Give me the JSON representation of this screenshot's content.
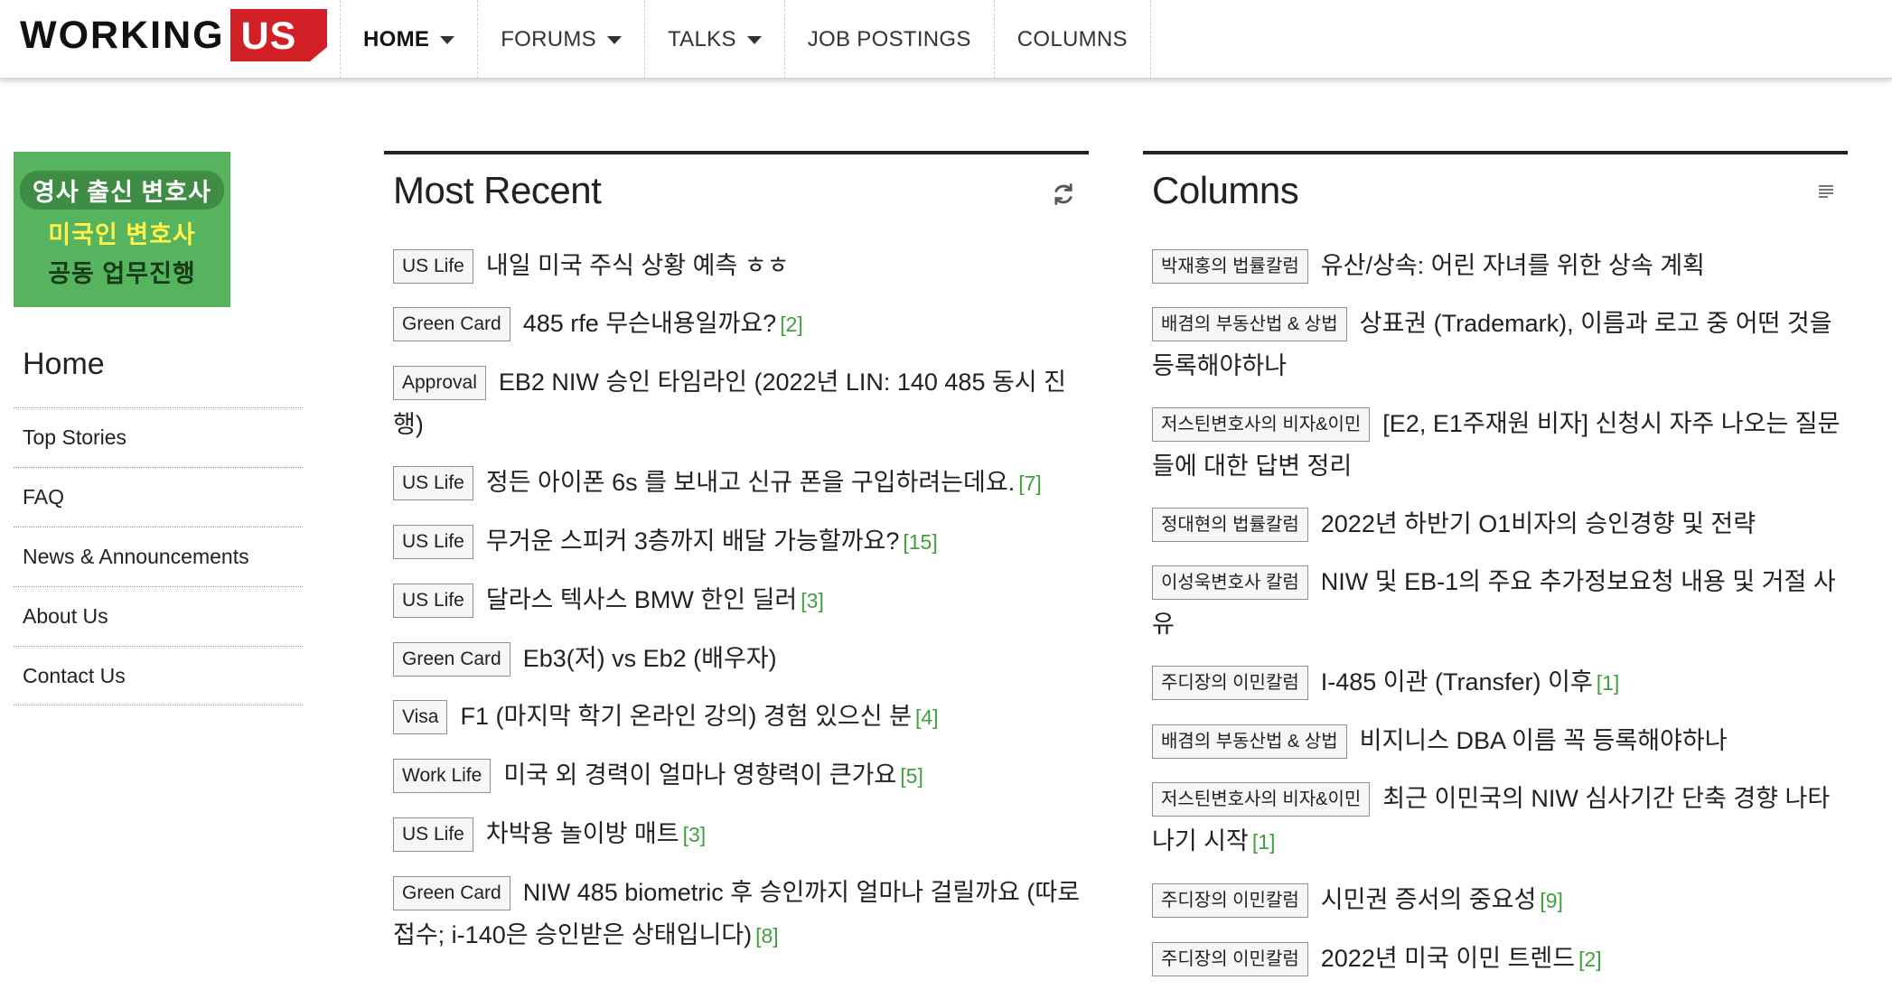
{
  "logo": {
    "word": "WORKING",
    "badge": "US"
  },
  "nav": [
    {
      "label": "HOME",
      "active": true,
      "dropdown": true
    },
    {
      "label": "FORUMS",
      "active": false,
      "dropdown": true
    },
    {
      "label": "TALKS",
      "active": false,
      "dropdown": true
    },
    {
      "label": "JOB POSTINGS",
      "active": false,
      "dropdown": false
    },
    {
      "label": "COLUMNS",
      "active": false,
      "dropdown": false
    }
  ],
  "ad": {
    "line1": "영사 출신 변호사",
    "line2": "미국인 변호사",
    "line3": "공동 업무진행"
  },
  "sidebar": {
    "title": "Home",
    "items": [
      "Top Stories",
      "FAQ",
      "News & Announcements",
      "About Us",
      "Contact Us"
    ]
  },
  "most_recent": {
    "title": "Most Recent",
    "icon": "refresh-icon",
    "items": [
      {
        "tag": "US Life",
        "title": "내일 미국 주식 상황 예측 ㅎㅎ",
        "count": ""
      },
      {
        "tag": "Green Card",
        "title": "485 rfe 무슨내용일까요?",
        "count": "[2]"
      },
      {
        "tag": "Approval",
        "title": "EB2 NIW 승인 타임라인 (2022년 LIN: 140 485 동시 진행)",
        "count": ""
      },
      {
        "tag": "US Life",
        "title": "정든 아이폰 6s 를 보내고 신규 폰을 구입하려는데요.",
        "count": "[7]"
      },
      {
        "tag": "US Life",
        "title": "무거운 스피커 3층까지 배달 가능할까요?",
        "count": "[15]"
      },
      {
        "tag": "US Life",
        "title": "달라스 텍사스 BMW 한인 딜러",
        "count": "[3]"
      },
      {
        "tag": "Green Card",
        "title": "Eb3(저) vs Eb2 (배우자)",
        "count": ""
      },
      {
        "tag": "Visa",
        "title": "F1 (마지막 학기 온라인 강의) 경험 있으신 분",
        "count": "[4]"
      },
      {
        "tag": "Work Life",
        "title": "미국 외 경력이 얼마나 영향력이 큰가요",
        "count": "[5]"
      },
      {
        "tag": "US Life",
        "title": "차박용 놀이방 매트",
        "count": "[3]"
      },
      {
        "tag": "Green Card",
        "title": "NIW 485 biometric 후 승인까지 얼마나 걸릴까요 (따로 접수; i-140은 승인받은 상태입니다)",
        "count": "[8]"
      }
    ]
  },
  "columns": {
    "title": "Columns",
    "icon": "list-icon",
    "items": [
      {
        "tag": "박재홍의 법률칼럼",
        "title": "유산/상속: 어린 자녀를 위한 상속 계획",
        "count": ""
      },
      {
        "tag": "배겸의 부동산법 & 상법",
        "title": "상표권 (Trademark), 이름과 로고 중 어떤 것을 등록해야하나",
        "count": ""
      },
      {
        "tag": "저스틴변호사의 비자&이민",
        "title": "[E2, E1주재원 비자] 신청시 자주 나오는 질문들에 대한 답변 정리",
        "count": ""
      },
      {
        "tag": "정대현의 법률칼럼",
        "title": "2022년 하반기 O1비자의 승인경향 및 전략",
        "count": ""
      },
      {
        "tag": "이성욱변호사 칼럼",
        "title": "NIW 및 EB-1의 주요 추가정보요청 내용 및 거절 사유",
        "count": ""
      },
      {
        "tag": "주디장의 이민칼럼",
        "title": "I-485 이관 (Transfer) 이후",
        "count": "[1]"
      },
      {
        "tag": "배겸의 부동산법 & 상법",
        "title": "비지니스 DBA 이름 꼭 등록해야하나",
        "count": ""
      },
      {
        "tag": "저스틴변호사의 비자&이민",
        "title": "최근 이민국의 NIW 심사기간 단축 경향 나타나기 시작",
        "count": "[1]"
      },
      {
        "tag": "주디장의 이민칼럼",
        "title": "시민권 증서의 중요성",
        "count": "[9]"
      },
      {
        "tag": "주디장의 이민칼럼",
        "title": "2022년 미국 이민 트렌드",
        "count": "[2]"
      }
    ]
  }
}
